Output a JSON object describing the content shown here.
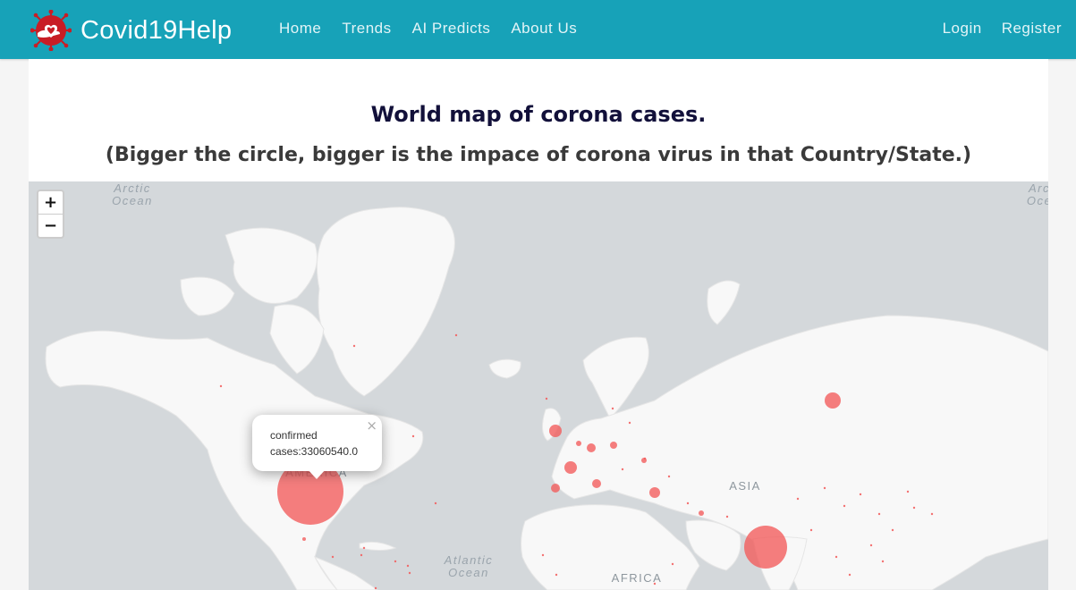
{
  "navbar": {
    "brand": "Covid19Help",
    "links": [
      "Home",
      "Trends",
      "AI Predicts",
      "About Us"
    ],
    "auth": [
      "Login",
      "Register"
    ],
    "background": "#17a2b8",
    "logo_icon": "virus-heart-logo-icon"
  },
  "page": {
    "title": "World map of corona cases.",
    "subtitle": "(Bigger the circle, bigger is the impace of corona virus in that Country/State.)"
  },
  "map": {
    "zoom_in_label": "+",
    "zoom_out_label": "−",
    "labels": {
      "arctic_left_1": "Arctic",
      "arctic_left_2": "Ocean",
      "arctic_right_1": "Arc",
      "arctic_right_2": "Oce",
      "atlantic_1": "Atlantic",
      "atlantic_2": "Ocean",
      "america_partial": "AMERICA",
      "asia": "ASIA",
      "africa": "AFRICA"
    },
    "popup": {
      "line1": "confirmed",
      "line2": "cases:33060540.0",
      "close": "×"
    },
    "marker_color": "#f25a5a"
  }
}
